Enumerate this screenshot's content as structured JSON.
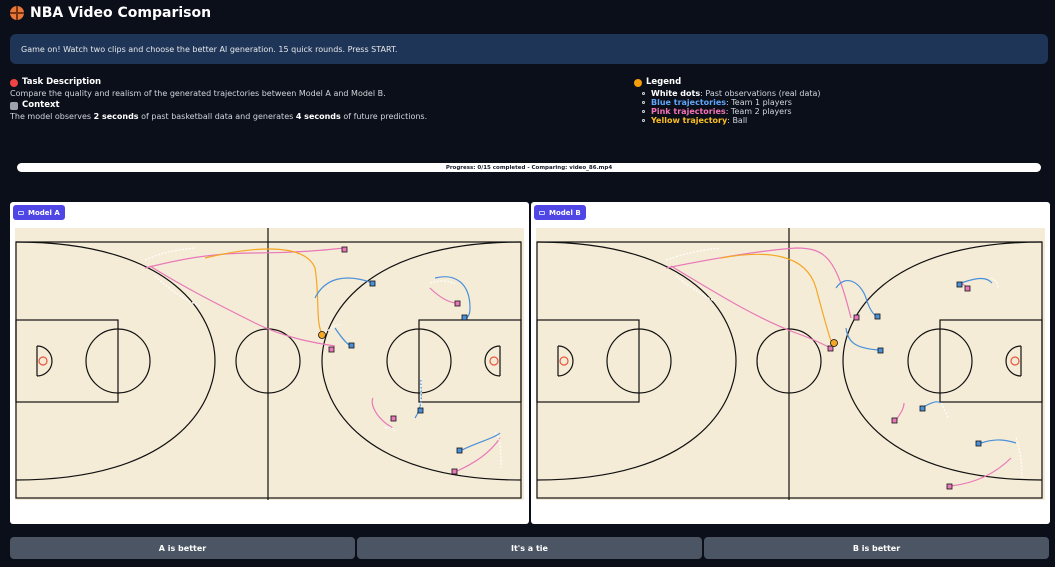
{
  "header": {
    "title": "NBA Video Comparison",
    "icon": "basketball-icon"
  },
  "banner": {
    "text": "Game on! Watch two clips and choose the better AI generation. 15 quick rounds. Press START."
  },
  "task": {
    "heading": "Task Description",
    "text": "Compare the quality and realism of the generated trajectories between Model A and Model B."
  },
  "context": {
    "heading": "Context",
    "pre": "The model observes ",
    "past": "2 seconds",
    "mid": " of past basketball data and generates ",
    "future": "4 seconds",
    "post": " of future predictions."
  },
  "legend": {
    "heading": "Legend",
    "items": [
      {
        "term": "White dots",
        "desc": ": Past observations (real data)"
      },
      {
        "term": "Blue trajectories",
        "desc": ": Team 1 players"
      },
      {
        "term": "Pink trajectories",
        "desc": ": Team 2 players"
      },
      {
        "term": "Yellow trajectory",
        "desc": ": Ball"
      }
    ]
  },
  "progress": {
    "text": "Progress: 0/15 completed - Comparing: video_86.mp4",
    "completed": 0,
    "total": 15
  },
  "panels": {
    "a_label": "Model A",
    "b_label": "Model B"
  },
  "buttons": {
    "a_better": "A is better",
    "tie": "It's a tie",
    "b_better": "B is better"
  },
  "colors": {
    "background": "#0b0f19",
    "banner": "#1f3557",
    "accent": "#4f46e5",
    "court": "#f5ecd7",
    "team1": "#4a90d9",
    "team2": "#e879b8",
    "ball": "#f5a623",
    "button": "#4b5563"
  }
}
